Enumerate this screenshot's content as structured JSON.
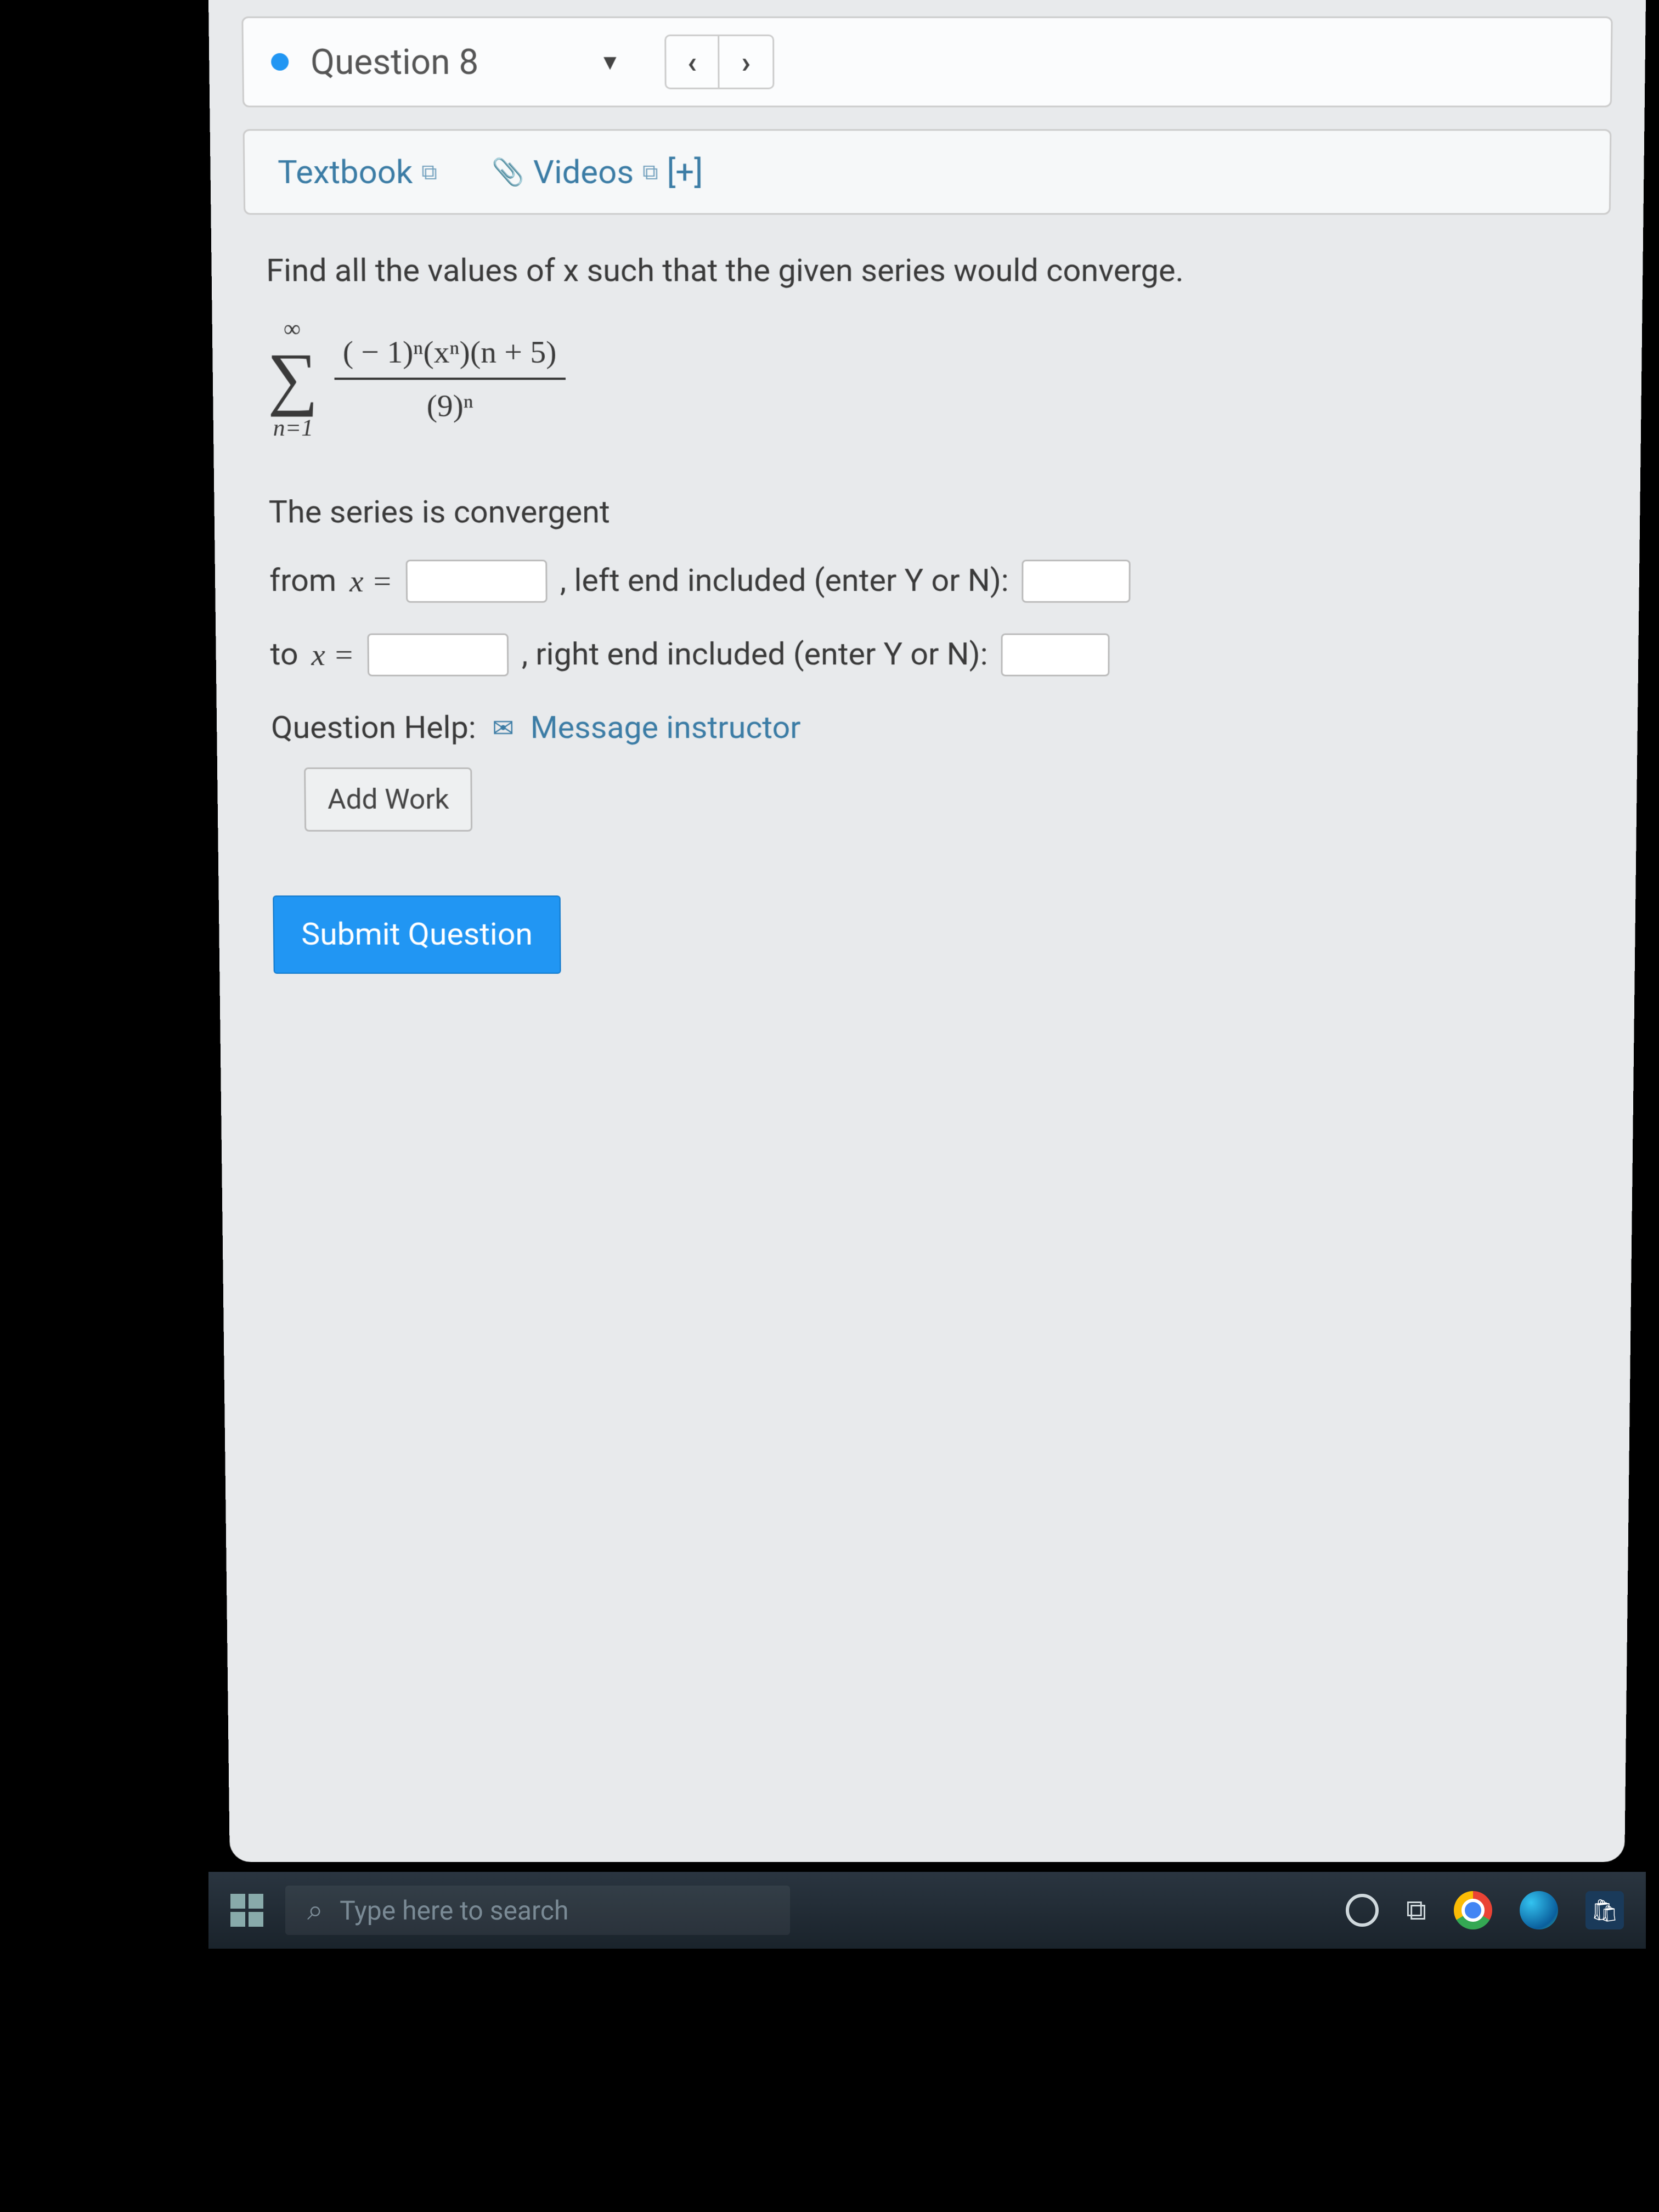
{
  "header": {
    "question_label": "Question 8",
    "prev_symbol": "‹",
    "next_symbol": "›"
  },
  "resources": {
    "textbook": "Textbook",
    "videos": "Videos",
    "plus": "[+]"
  },
  "question": {
    "prompt": "Find all the values of x such that the given series would converge.",
    "sigma_top": "∞",
    "sigma_bottom": "n=1",
    "numerator": "( − 1)ⁿ(xⁿ)(n + 5)",
    "denominator": "(9)ⁿ",
    "convergent_title": "The series is convergent",
    "from_label": "from",
    "from_var": "x =",
    "from_tail": ", left end included (enter Y or N):",
    "to_label": "to",
    "to_var": "x =",
    "to_tail": ", right end included (enter Y or N):",
    "help_label": "Question Help:",
    "help_link": "Message instructor",
    "add_work": "Add Work",
    "submit": "Submit Question"
  },
  "taskbar": {
    "search_placeholder": "Type here to search"
  }
}
